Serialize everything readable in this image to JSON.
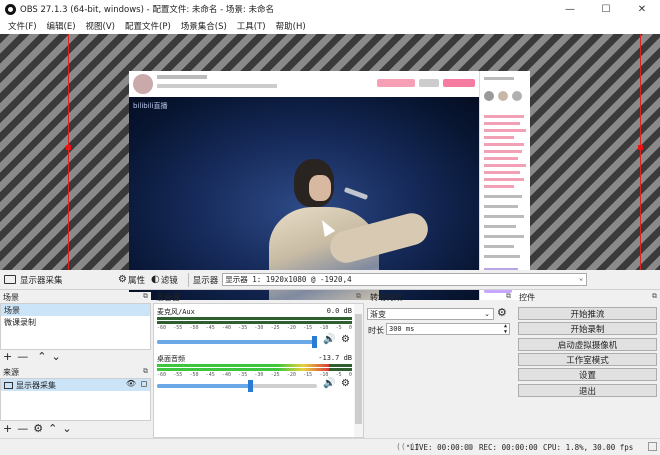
{
  "window": {
    "title": "OBS 27.1.3 (64-bit, windows) - 配置文件: 未命名 - 场景: 未命名",
    "minimize": "—",
    "maximize": "☐",
    "close": "✕"
  },
  "menu": [
    "文件(F)",
    "编辑(E)",
    "视图(V)",
    "配置文件(P)",
    "场景集合(S)",
    "工具(T)",
    "帮助(H)"
  ],
  "preview": {
    "capture_logo": "bilibili直播"
  },
  "source_toolbar": {
    "source_name": "显示器采集",
    "properties": "属性",
    "filters": "滤镜",
    "display_label": "显示器",
    "display_value": "显示器 1: 1920x1080 @ -1920,4"
  },
  "scenes": {
    "title": "场景",
    "items": [
      "场景",
      "微课录制"
    ],
    "selected_index": 0
  },
  "sources": {
    "title": "来源",
    "items": [
      {
        "name": "显示器采集",
        "visible_icon": "eye-icon",
        "lock_icon": "lock-icon"
      }
    ]
  },
  "mixer": {
    "title": "混音器",
    "channels": [
      {
        "name": "麦克风/Aux",
        "db": "0.0 dB",
        "level_fraction": 0.0,
        "fader_fraction": 0.98
      },
      {
        "name": "桌面音频",
        "db": "-13.7 dB",
        "level_fraction": 0.88,
        "fader_fraction": 0.58
      }
    ],
    "ticks": [
      "-60",
      "-55",
      "-50",
      "-45",
      "-40",
      "-35",
      "-30",
      "-25",
      "-20",
      "-15",
      "-10",
      "-5",
      "0"
    ]
  },
  "transitions": {
    "title": "转场特效",
    "selected": "渐变",
    "duration_label": "时长",
    "duration_value": "300 ms"
  },
  "controls": {
    "title": "控件",
    "buttons": [
      "开始推流",
      "开始录制",
      "启动虚拟摄像机",
      "工作室模式",
      "设置",
      "退出"
    ]
  },
  "status": {
    "live": "LIVE: 00:00:00",
    "rec": "REC: 00:00:00",
    "cpu": "CPU: 1.8%, 30.00 fps"
  },
  "colors": {
    "selection": "#cce4f7",
    "preview_border": "#dd2222",
    "fader_knob": "#2a7bd4"
  }
}
